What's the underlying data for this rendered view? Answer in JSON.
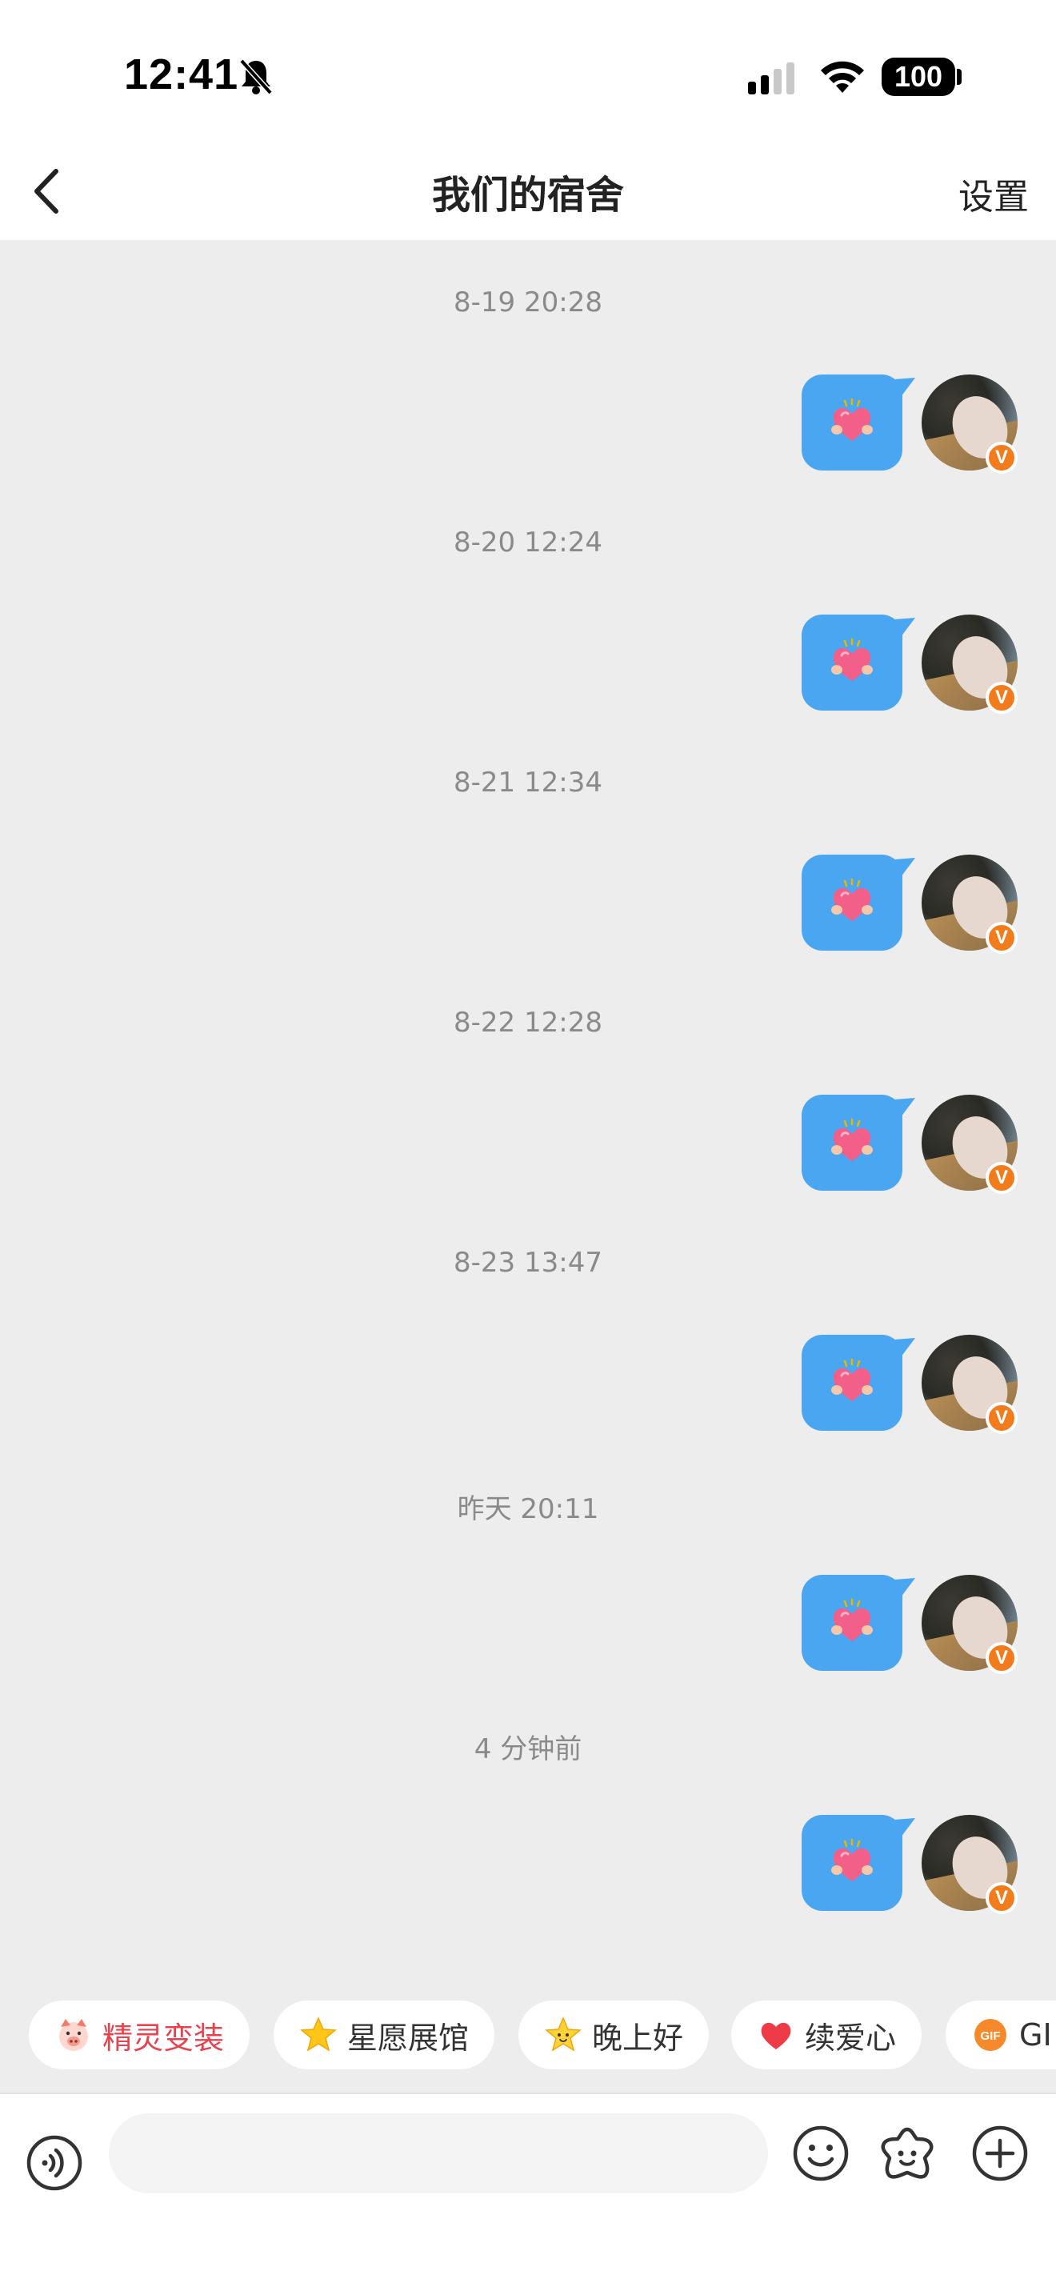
{
  "status_bar": {
    "time": "12:41",
    "battery": "100"
  },
  "nav": {
    "title": "我们的宿舍",
    "settings_label": "设置"
  },
  "messages": [
    {
      "time": "8-19 20:28",
      "content": "heart-sticker"
    },
    {
      "time": "8-20 12:24",
      "content": "heart-sticker"
    },
    {
      "time": "8-21 12:34",
      "content": "heart-sticker"
    },
    {
      "time": "8-22 12:28",
      "content": "heart-sticker"
    },
    {
      "time": "8-23 13:47",
      "content": "heart-sticker"
    },
    {
      "time": "昨天 20:11",
      "content": "heart-sticker"
    },
    {
      "time": "4 分钟前",
      "content": "heart-sticker"
    }
  ],
  "avatar_badge": "V",
  "quick_chips": [
    {
      "label": "精灵变装",
      "icon": "pig-face-icon",
      "color": "#e8424e"
    },
    {
      "label": "星愿展馆",
      "icon": "star-icon",
      "color": "#333333"
    },
    {
      "label": "晚上好",
      "icon": "star-face-icon",
      "color": "#333333"
    },
    {
      "label": "续爱心",
      "icon": "heart-icon",
      "color": "#333333"
    },
    {
      "label": "GI",
      "icon": "gif-icon",
      "color": "#333333"
    }
  ],
  "input": {
    "placeholder": ""
  },
  "colors": {
    "bubble": "#4aa6f0",
    "chat_background": "#ededed",
    "vip_badge": "#f27c1c"
  }
}
